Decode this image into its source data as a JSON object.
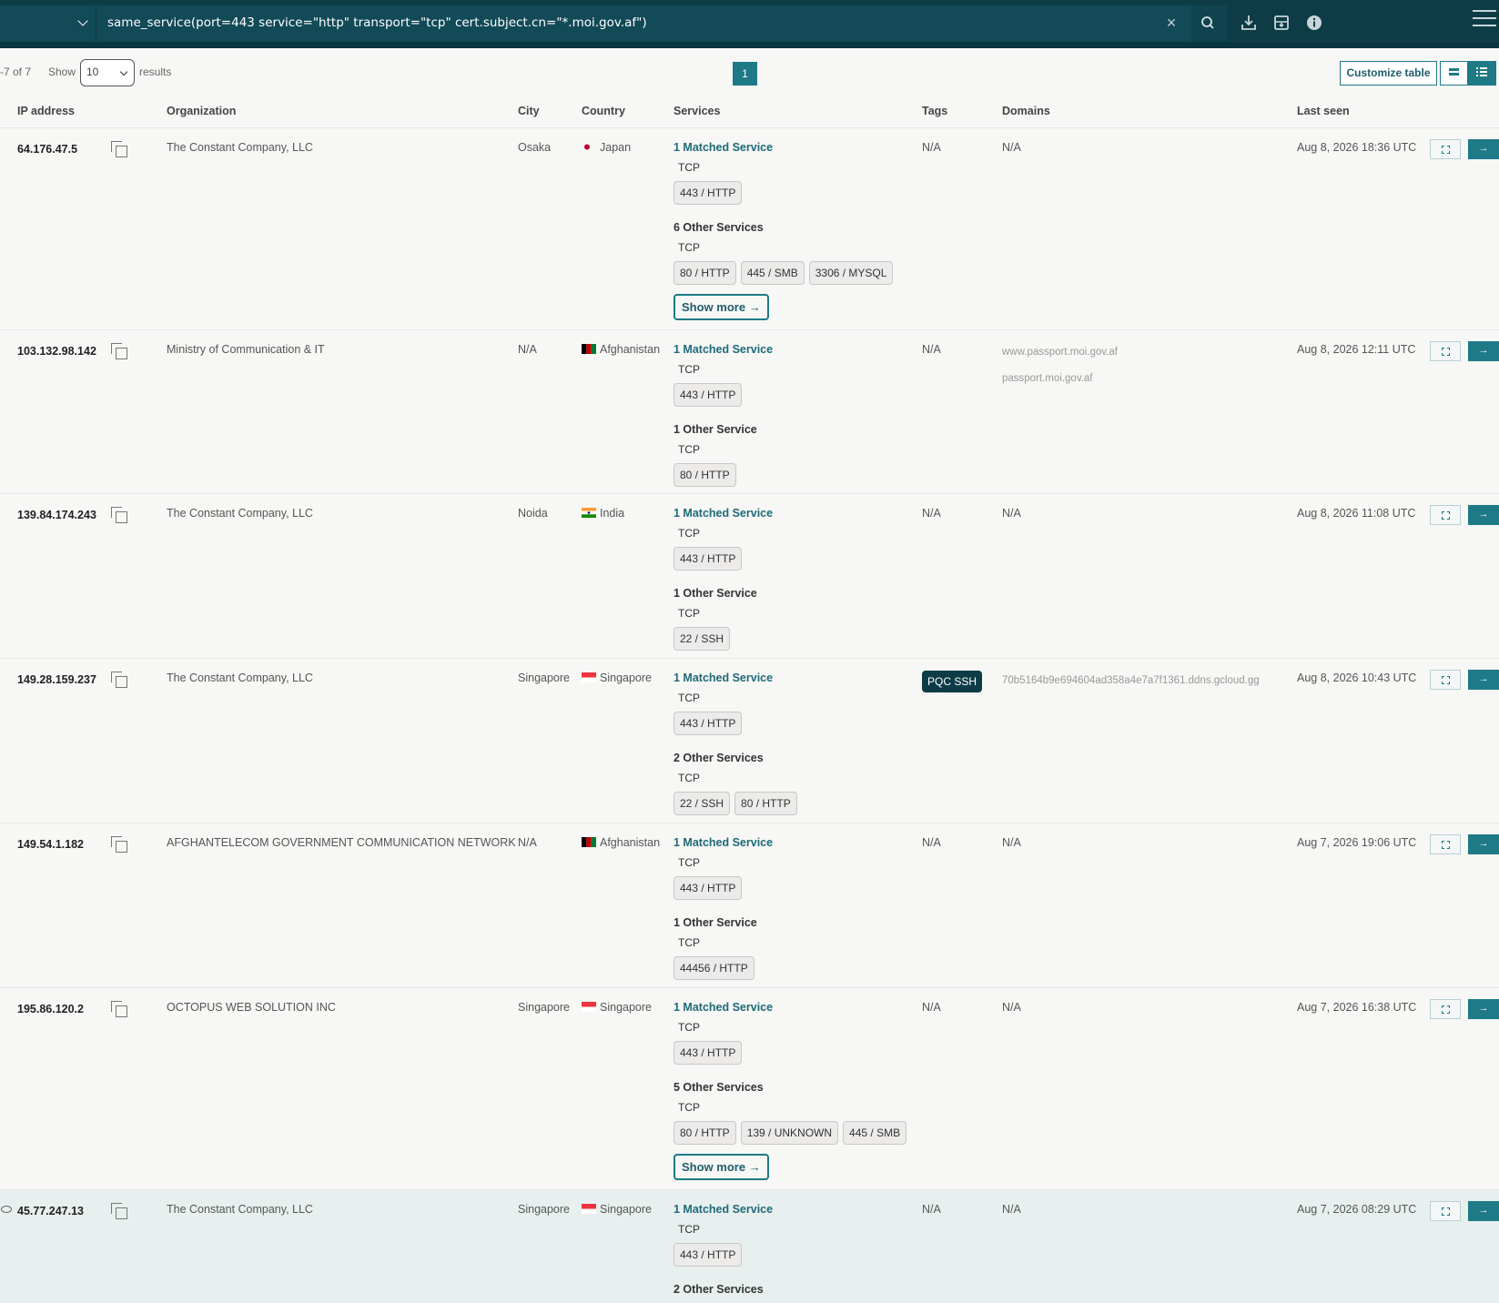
{
  "search": {
    "query": "same_service(port=443 service=\"http\" transport=\"tcp\" cert.subject.cn=\"*.moi.gov.af\")",
    "clear": "×"
  },
  "controls": {
    "count": "-7 of 7",
    "show_label": "Show",
    "page_size": "10",
    "results_label": "results",
    "page": "1",
    "customize": "Customize table"
  },
  "columns": {
    "ip": "IP address",
    "org": "Organization",
    "city": "City",
    "country": "Country",
    "services": "Services",
    "tags": "Tags",
    "domains": "Domains",
    "last_seen": "Last seen"
  },
  "rows": [
    {
      "ip": "64.176.47.5",
      "org": "The Constant Company, LLC",
      "city": "Osaka",
      "country": "Japan",
      "matched": "1 Matched Service",
      "matched_proto": "TCP",
      "matched_chips": [
        "443 / HTTP"
      ],
      "other": "6 Other Services",
      "other_proto": "TCP",
      "other_chips": [
        "80 / HTTP",
        "445 / SMB",
        "3306 / MYSQL"
      ],
      "show_more": "Show more",
      "tags": "N/A",
      "domains": [
        "N/A"
      ],
      "last_seen": "Aug 8, 2026 18:36 UTC"
    },
    {
      "ip": "103.132.98.142",
      "org": "Ministry of Communication & IT",
      "city": "N/A",
      "country": "Afghanistan",
      "matched": "1 Matched Service",
      "matched_proto": "TCP",
      "matched_chips": [
        "443 / HTTP"
      ],
      "other": "1 Other Service",
      "other_proto": "TCP",
      "other_chips": [
        "80 / HTTP"
      ],
      "tags": "N/A",
      "domains": [
        "www.passport.moi.gov.af",
        "passport.moi.gov.af"
      ],
      "last_seen": "Aug 8, 2026 12:11 UTC"
    },
    {
      "ip": "139.84.174.243",
      "org": "The Constant Company, LLC",
      "city": "Noida",
      "country": "India",
      "matched": "1 Matched Service",
      "matched_proto": "TCP",
      "matched_chips": [
        "443 / HTTP"
      ],
      "other": "1 Other Service",
      "other_proto": "TCP",
      "other_chips": [
        "22 / SSH"
      ],
      "tags": "N/A",
      "domains": [
        "N/A"
      ],
      "last_seen": "Aug 8, 2026 11:08 UTC"
    },
    {
      "ip": "149.28.159.237",
      "org": "The Constant Company, LLC",
      "city": "Singapore",
      "country": "Singapore",
      "matched": "1 Matched Service",
      "matched_proto": "TCP",
      "matched_chips": [
        "443 / HTTP"
      ],
      "other": "2 Other Services",
      "other_proto": "TCP",
      "other_chips": [
        "22 / SSH",
        "80 / HTTP"
      ],
      "tag_badge": "PQC SSH",
      "domains": [
        "70b5164b9e694604ad358a4e7a7f1361.ddns.gcloud.gg"
      ],
      "last_seen": "Aug 8, 2026 10:43 UTC"
    },
    {
      "ip": "149.54.1.182",
      "org": "AFGHANTELECOM GOVERNMENT COMMUNICATION NETWORK",
      "city": "N/A",
      "country": "Afghanistan",
      "matched": "1 Matched Service",
      "matched_proto": "TCP",
      "matched_chips": [
        "443 / HTTP"
      ],
      "other": "1 Other Service",
      "other_proto": "TCP",
      "other_chips": [
        "44456 / HTTP"
      ],
      "tags": "N/A",
      "domains": [
        "N/A"
      ],
      "last_seen": "Aug 7, 2026 19:06 UTC"
    },
    {
      "ip": "195.86.120.2",
      "org": "OCTOPUS WEB SOLUTION INC",
      "city": "Singapore",
      "country": "Singapore",
      "matched": "1 Matched Service",
      "matched_proto": "TCP",
      "matched_chips": [
        "443 / HTTP"
      ],
      "other": "5 Other Services",
      "other_proto": "TCP",
      "other_chips": [
        "80 / HTTP",
        "139 / UNKNOWN",
        "445 / SMB"
      ],
      "show_more": "Show more",
      "tags": "N/A",
      "domains": [
        "N/A"
      ],
      "last_seen": "Aug 7, 2026 16:38 UTC"
    },
    {
      "ip": "45.77.247.13",
      "org": "The Constant Company, LLC",
      "city": "Singapore",
      "country": "Singapore",
      "matched": "1 Matched Service",
      "matched_proto": "TCP",
      "matched_chips": [
        "443 / HTTP"
      ],
      "other": "2 Other Services",
      "tags": "N/A",
      "domains": [
        "N/A"
      ],
      "last_seen": "Aug 7, 2026 08:29 UTC"
    }
  ],
  "icons": {
    "search": "search-icon",
    "download": "download-icon",
    "archive": "archive-icon",
    "info": "info-icon",
    "menu": "hamburger-menu-icon",
    "copy": "copy-icon",
    "expand": "expand-icon",
    "arrow": "arrow-right-icon"
  },
  "colors": {
    "topbar": "#0d3c47",
    "accent": "#1e7a86",
    "matched": "#1e6a78"
  }
}
